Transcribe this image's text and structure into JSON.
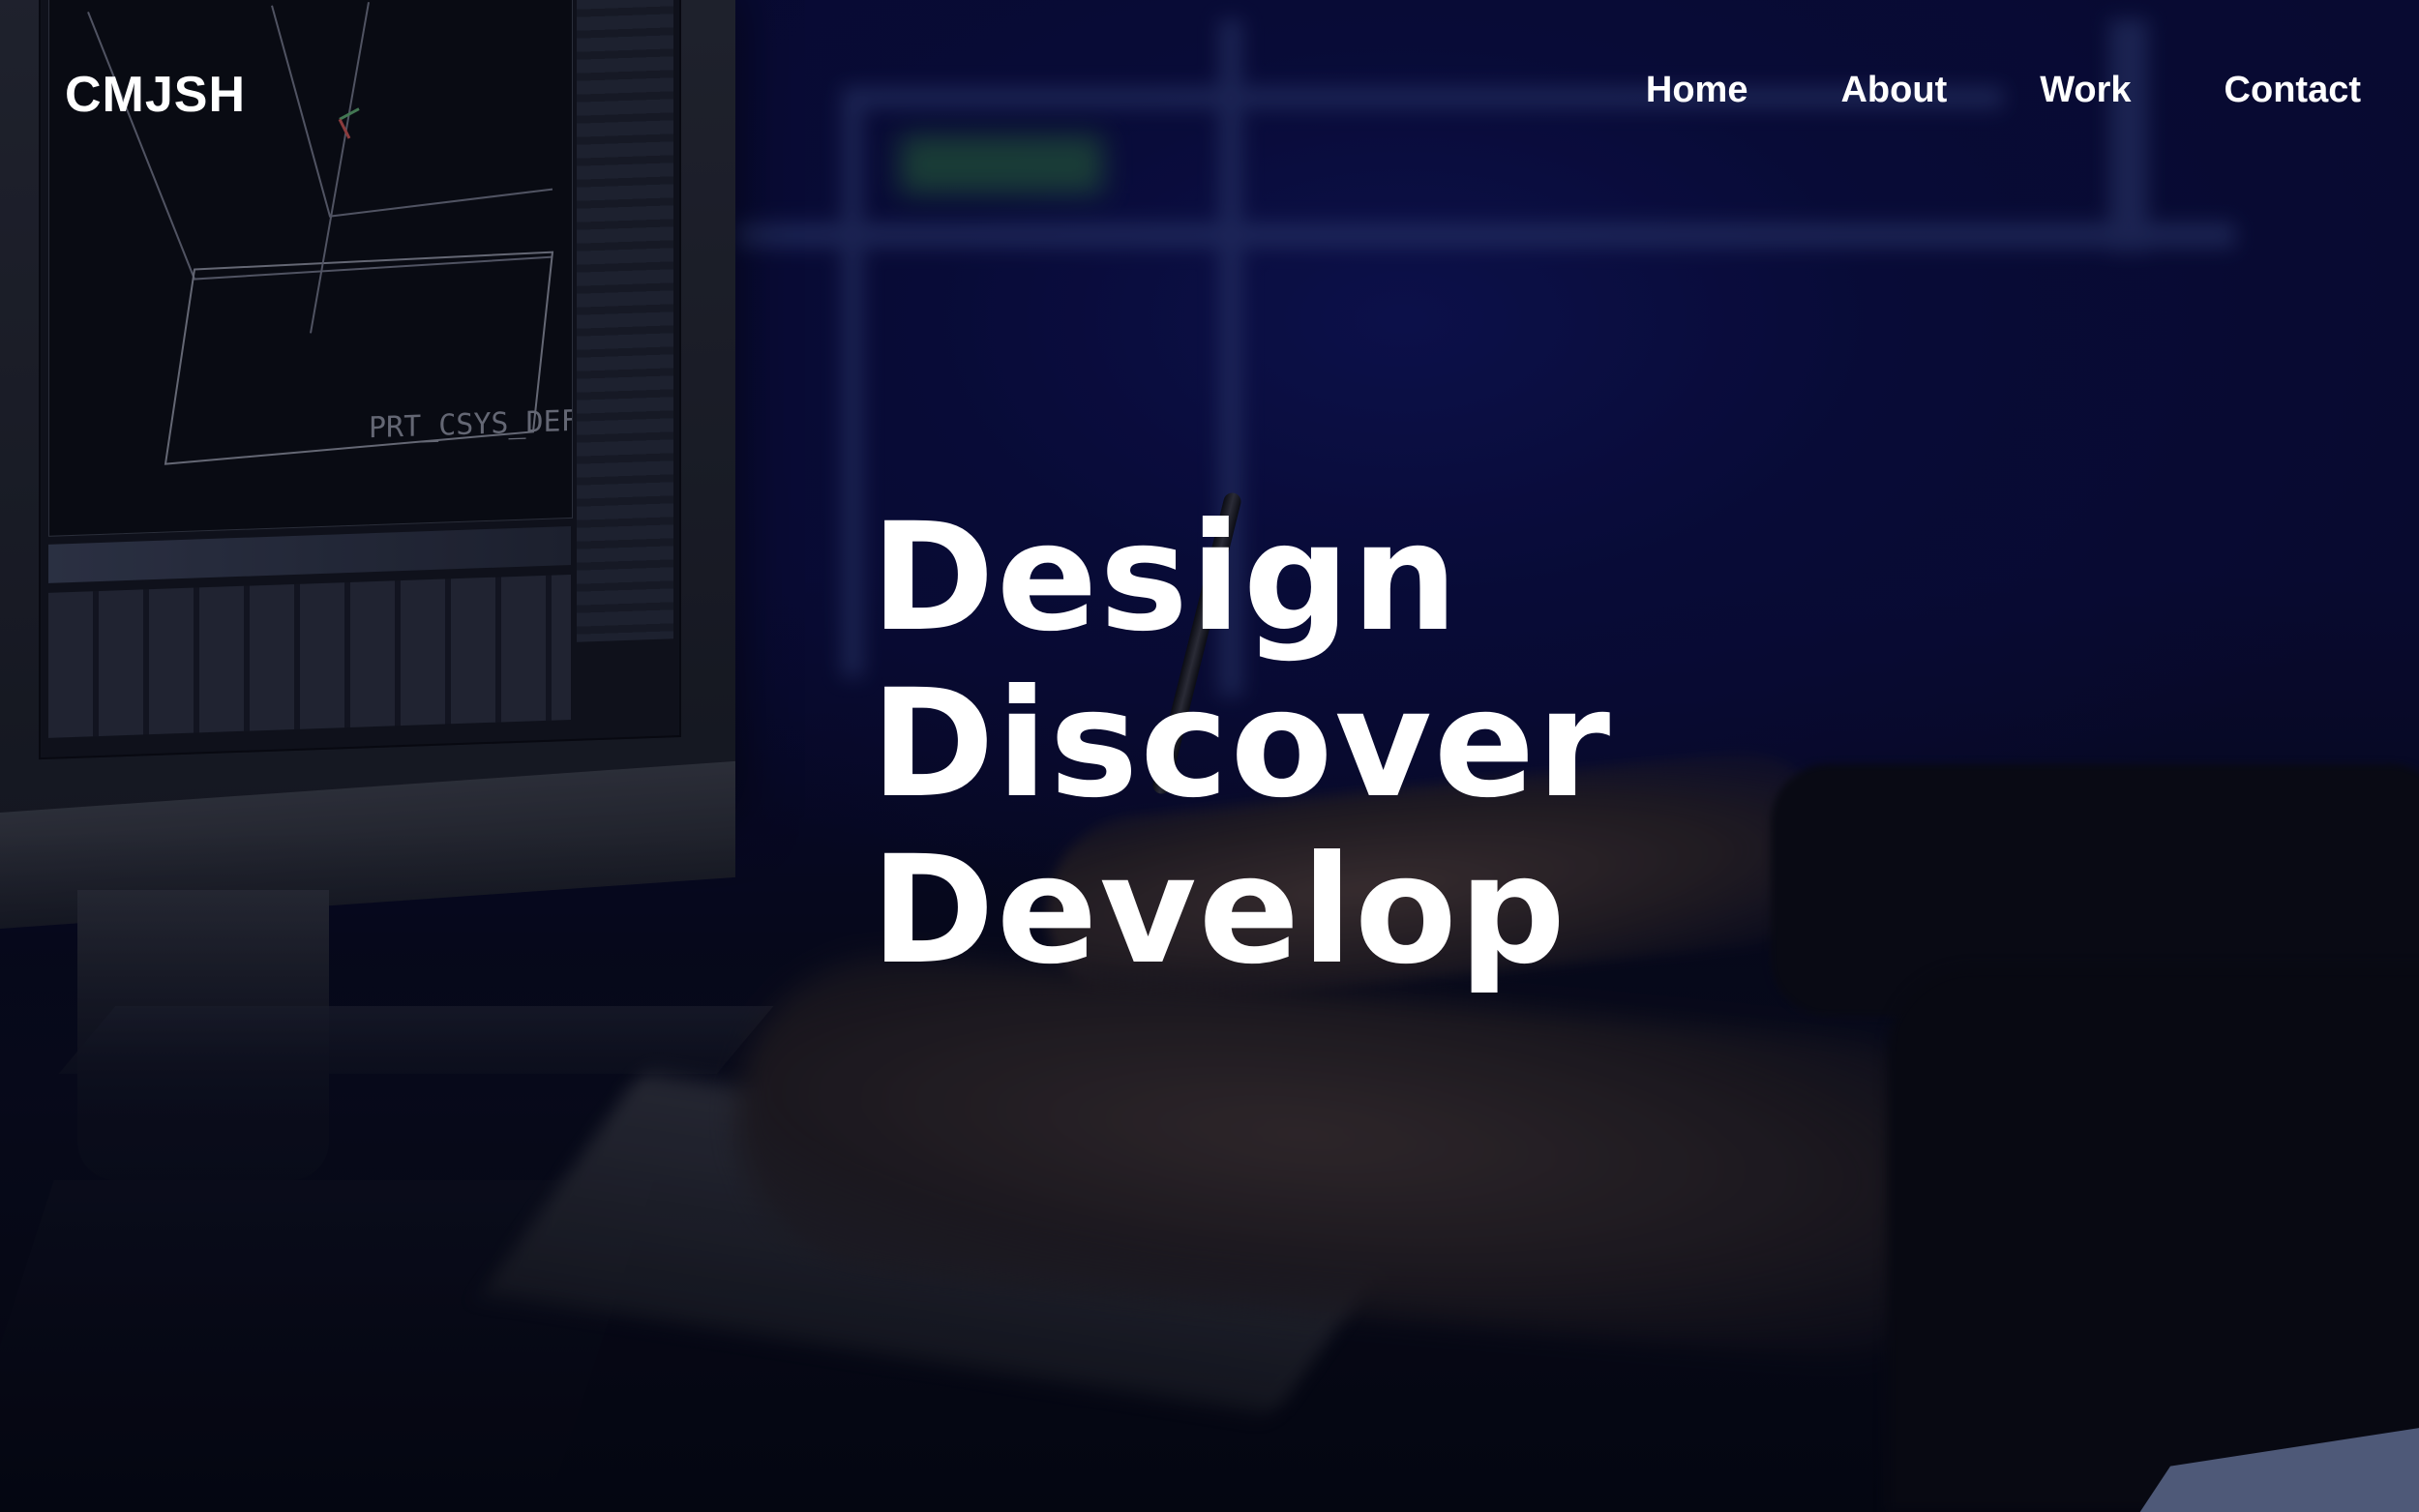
{
  "site": {
    "logo": "CMJSH"
  },
  "nav": {
    "items": [
      {
        "label": "Home"
      },
      {
        "label": "About"
      },
      {
        "label": "Work"
      },
      {
        "label": "Contact"
      }
    ]
  },
  "hero": {
    "lines": [
      "Design",
      "Discover",
      "Develop"
    ]
  },
  "background": {
    "description_icon": "photo-background",
    "monitor_label": "PRT_CSYS_DEF"
  }
}
